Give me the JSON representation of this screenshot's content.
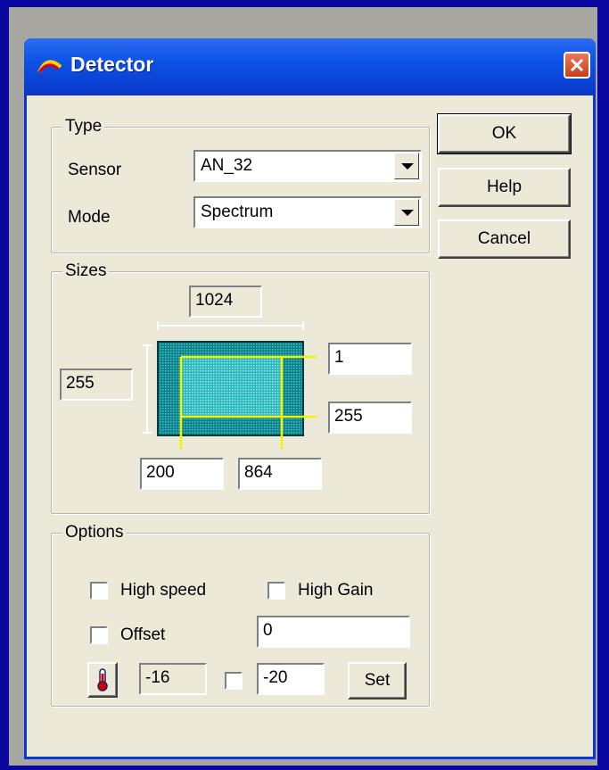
{
  "window": {
    "title": "Detector"
  },
  "actions": {
    "ok": "OK",
    "help": "Help",
    "cancel": "Cancel"
  },
  "type_group": {
    "label": "Type",
    "sensor_label": "Sensor",
    "sensor_value": "AN_32",
    "mode_label": "Mode",
    "mode_value": "Spectrum"
  },
  "sizes_group": {
    "label": "Sizes",
    "width_total": "1024",
    "height_total": "255",
    "roi_top": "1",
    "roi_bottom": "255",
    "roi_left": "200",
    "roi_right": "864"
  },
  "options_group": {
    "label": "Options",
    "high_speed_label": "High speed",
    "high_gain_label": "High Gain",
    "offset_label": "Offset",
    "offset_value": "0",
    "temperature_value": "-16",
    "temperature_setpoint": "-20",
    "set_label": "Set"
  },
  "icons": {
    "title": "app-logo-icon",
    "close": "close-icon",
    "temperature": "thermometer-icon"
  },
  "colors": {
    "titlebar": "#0a46d8",
    "desktop": "#08069e",
    "sensor_fill": "#1aa7b0",
    "roi_line": "#f4f400"
  }
}
